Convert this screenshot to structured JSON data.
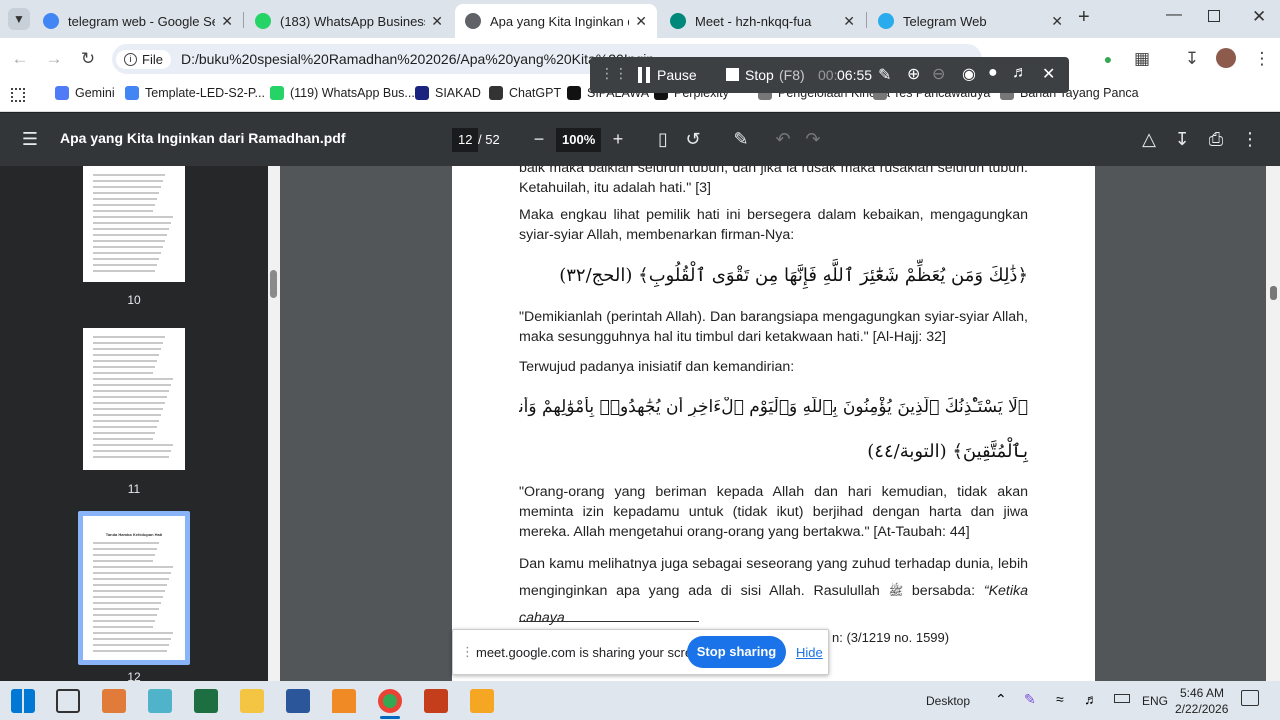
{
  "tabs": [
    {
      "title": "telegram web - Google Sear",
      "icon": "google-icon",
      "color": "#4285f4",
      "active": false
    },
    {
      "title": "(183) WhatsApp Business",
      "icon": "whatsapp-icon",
      "color": "#25d366",
      "active": false
    },
    {
      "title": "Apa yang Kita Inginkan dari",
      "icon": "pdf-icon",
      "color": "#5f6368",
      "active": true
    },
    {
      "title": "Meet - hzh-nkqq-fua",
      "icon": "meet-icon",
      "color": "#00897b",
      "active": false
    },
    {
      "title": "Telegram Web",
      "icon": "telegram-icon",
      "color": "#2aabee",
      "active": false
    }
  ],
  "omnibox": {
    "chip": "File",
    "url": "D:/buku%20spesial%20Ramadhan%202026/Apa%20yang%20Kita%20Ingin..."
  },
  "bookmarks": [
    {
      "label": "Gemini",
      "color": "#4f7cf6"
    },
    {
      "label": "Template-LED-S2-P...",
      "color": "#4285f4"
    },
    {
      "label": "(119) WhatsApp Bus...",
      "color": "#25d366"
    },
    {
      "label": "SIAKAD",
      "color": "#1a237e"
    },
    {
      "label": "ChatGPT",
      "color": "#333333"
    },
    {
      "label": "SIPALAWA",
      "color": "#111111"
    },
    {
      "label": "Perplexity",
      "color": "#111111"
    },
    {
      "label": "Pengelolaan Kinerja",
      "color": "#777777"
    },
    {
      "label": "Tes Pancawaluya",
      "color": "#777777"
    },
    {
      "label": "Bahan Tayang Panca",
      "color": "#777777"
    }
  ],
  "recorder": {
    "pause": "Pause",
    "stop": "Stop",
    "stop_key": "(F8)",
    "time_prefix": "00:",
    "time": "06:55"
  },
  "pdf": {
    "title": "Apa yang Kita Inginkan dari Ramadhan.pdf",
    "page_current": "12",
    "page_total": "/ 52",
    "zoom": "100%"
  },
  "thumbs": [
    {
      "number": "10"
    },
    {
      "number": "11"
    },
    {
      "number": "12"
    }
  ],
  "thumb_title": "Tanda Hamba Kehidupan Hati",
  "content": {
    "p0": "baik maka baiklah seluruh tubuh, dan jika ia rusak maka rusaklah seluruh tubuh. Ketahuilah, itu adalah hati.\" [3]",
    "p1": "Maka engkau lihat pemilik hati ini bersegera dalam kebaikan, mengagungkan syiar-syiar Allah, membenarkan firman-Nya:",
    "a1": "﴿ذَٰلِكَ وَمَن يُعَظِّمْ شَعَٰٓئِرَ ٱللَّهِ فَإِنَّهَا مِن تَقْوَى ٱلْقُلُوبِ﴾ (الحج/٣٢)",
    "p2": "\"Demikianlah (perintah Allah). Dan barangsiapa mengagungkan syiar-syiar Allah, maka sesungguhnya hal itu timbul dari ketakwaan hati.\" [Al-Hajj: 32]",
    "p3": "Terwujud padanya inisiatif dan kemandirian:",
    "a2": "﴿لَا يَسْتَـْٔذِنُكَ ٱلَّذِينَ يُؤْمِنُونَ بِٱللَّهِ وَٱلْيَوْمِ ٱلْءَاخِرِ أَن يُجَٰهِدُوا۟ بِأَمْوَٰلِهِمْ وَأَنفُسِهِمْ ۗ وَٱللَّهُ عَلِيمٌۢ",
    "a3": "بِٱلْمُتَّقِينَ﴾ (التوبة/٤٤)",
    "p4": "\"Orang-orang yang beriman kepada Allah dan hari kemudian, tidak akan meminta izin kepadamu untuk (tidak ikut) berjihad dengan harta dan jiwa mereka. Allah mengetahui orang-orang yang bertakwa.\" [At-Taubah: 44]",
    "p5a": "Dan kamu melihatnya juga sebagai seseorang yang zuhud terhadap dunia, lebih menginginkan apa yang ada di sisi Allah. Rasulullah ",
    "p5b": " bersabda: ",
    "p5c": "“Ketika cahaya",
    "footnote": "n: (3/1219 no. 1599)"
  },
  "share": {
    "text": "meet.google.com is sharing your screen.",
    "stop": "Stop sharing",
    "hide": "Hide"
  },
  "taskbar": {
    "desktop": "Desktop",
    "lang": "ENG",
    "time": "5:46 AM",
    "date": "2/22/2026"
  }
}
